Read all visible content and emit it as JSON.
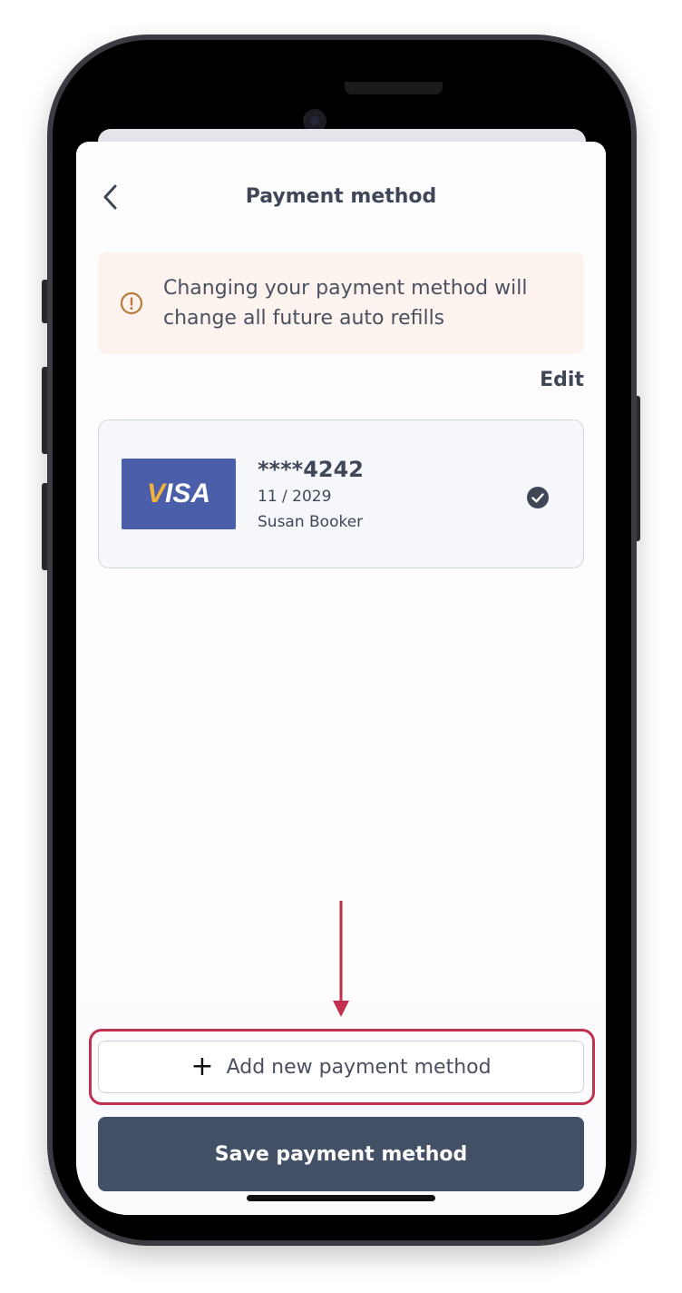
{
  "header": {
    "title": "Payment method"
  },
  "alert": {
    "message": "Changing your payment method will change all future auto refills"
  },
  "actions": {
    "edit_label": "Edit"
  },
  "card": {
    "brand": "VISA",
    "number": "****4242",
    "expiry": "11 / 2029",
    "holder": "Susan Booker",
    "selected": true
  },
  "buttons": {
    "add_label": "Add new payment method",
    "save_label": "Save payment method"
  },
  "colors": {
    "primary": "#435066",
    "alert_bg": "#fdf3ee",
    "alert_icon": "#b87a3a",
    "annotation": "#c0304f",
    "visa_bg": "#4a5ea9"
  },
  "icons": {
    "back": "chevron-left-icon",
    "alert": "exclamation-circle-icon",
    "selected": "check-circle-icon",
    "add": "plus-icon"
  }
}
